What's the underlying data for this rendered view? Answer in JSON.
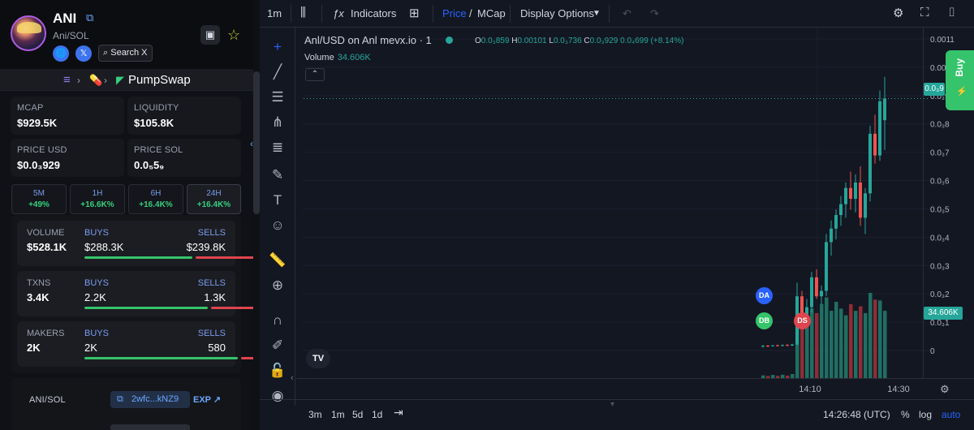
{
  "token": {
    "name": "ANI",
    "pair": "Ani/SOL",
    "search_label": "Search X"
  },
  "breadcrumb": {
    "dex": "PumpSwap"
  },
  "metrics": {
    "mcap_label": "MCAP",
    "mcap_value": "$929.5K",
    "liquidity_label": "LIQUIDITY",
    "liquidity_value": "$105.8K",
    "price_usd_label": "PRICE USD",
    "price_usd_value": "$0.0₃929",
    "price_sol_label": "PRICE SOL",
    "price_sol_value": "0.0₅5₉"
  },
  "timeframes": [
    {
      "label": "5M",
      "change": "+49%"
    },
    {
      "label": "1H",
      "change": "+16.6K%"
    },
    {
      "label": "6H",
      "change": "+16.4K%"
    },
    {
      "label": "24H",
      "change": "+16.4K%"
    }
  ],
  "stats": {
    "volume": {
      "label": "VOLUME",
      "value": "$528.1K",
      "buys_label": "BUYS",
      "buys": "$288.3K",
      "sells_label": "SELLS",
      "sells": "$239.8K",
      "buy_fraction": 0.55
    },
    "txns": {
      "label": "TXNS",
      "value": "3.4K",
      "buys_label": "BUYS",
      "buys": "2.2K",
      "sells_label": "SELLS",
      "sells": "1.3K",
      "buy_fraction": 0.63
    },
    "makers": {
      "label": "MAKERS",
      "value": "2K",
      "buys_label": "BUYS",
      "buys": "2K",
      "sells_label": "SELLS",
      "sells": "580",
      "buy_fraction": 0.78
    }
  },
  "pair_info": {
    "label": "ANI/SOL",
    "address": "2wfc...kNZ9",
    "exp_label": "EXP"
  },
  "chart_toolbar": {
    "interval": "1m",
    "indicators": "Indicators",
    "price_label": "Price",
    "mcap_label": "MCap",
    "display_options": "Display Options"
  },
  "chart_legend": {
    "symbol": "Anl/USD on Anl mevx.io · 1",
    "o_label": "O",
    "o_value": "0.0₃859",
    "h_label": "H",
    "h_value": "0.00101",
    "l_label": "L",
    "l_value": "0.0₃736",
    "c_label": "C",
    "c_value": "0.0₃929",
    "change": "0.0₄699 (+8.14%)",
    "volume_label": "Volume",
    "volume_value": "34.606K"
  },
  "markers": {
    "da": "DA",
    "db": "DB",
    "ds": "DS"
  },
  "price_tags": {
    "volume_tag": "34.606K",
    "price_tag": "0.0₃9"
  },
  "bottombar": {
    "ranges": [
      "3m",
      "1m",
      "5d",
      "1d"
    ],
    "time": "14:26:48 (UTC)",
    "percent": "%",
    "log": "log",
    "auto": "auto"
  },
  "buy_button": {
    "label": "Buy"
  },
  "chart_data": {
    "type": "candlestick",
    "y_ticks": [
      "0.0011",
      "0.001",
      "0.0₃9",
      "0.0₃8",
      "0.0₃7",
      "0.0₃6",
      "0.0₃5",
      "0.0₃4",
      "0.0₃3",
      "0.0₃2",
      "0.0₃1",
      "0"
    ],
    "ylim": [
      0,
      0.00115
    ],
    "x_ticks": [
      "14:10",
      "14:30"
    ],
    "candles": [
      {
        "o": 1.5e-05,
        "h": 2e-05,
        "l": 1e-05,
        "c": 1.8e-05
      },
      {
        "o": 1.8e-05,
        "h": 2e-05,
        "l": 1.2e-05,
        "c": 1.6e-05
      },
      {
        "o": 1.6e-05,
        "h": 2e-05,
        "l": 1.4e-05,
        "c": 1.9e-05
      },
      {
        "o": 1.9e-05,
        "h": 2.2e-05,
        "l": 1.5e-05,
        "c": 1.7e-05
      },
      {
        "o": 1.7e-05,
        "h": 2.2e-05,
        "l": 1.5e-05,
        "c": 2e-05
      },
      {
        "o": 2e-05,
        "h": 2.4e-05,
        "l": 1.6e-05,
        "c": 1.8e-05
      },
      {
        "o": 1.8e-05,
        "h": 2.5e-05,
        "l": 1.7e-05,
        "c": 2.2e-05
      },
      {
        "o": 2.2e-05,
        "h": 0.00025,
        "l": 2e-05,
        "c": 0.0002
      },
      {
        "o": 0.0002,
        "h": 0.00022,
        "l": 0.00011,
        "c": 0.00012
      },
      {
        "o": 0.00012,
        "h": 0.00019,
        "l": 0.0001,
        "c": 0.00016
      },
      {
        "o": 0.00016,
        "h": 0.00029,
        "l": 0.00014,
        "c": 0.00027
      },
      {
        "o": 0.00027,
        "h": 0.0003,
        "l": 0.00019,
        "c": 0.0002
      },
      {
        "o": 0.0002,
        "h": 0.00024,
        "l": 0.00017,
        "c": 0.00022
      },
      {
        "o": 0.00022,
        "h": 0.00043,
        "l": 0.0002,
        "c": 0.0004
      },
      {
        "o": 0.0004,
        "h": 0.00048,
        "l": 0.00035,
        "c": 0.00045
      },
      {
        "o": 0.00045,
        "h": 0.00052,
        "l": 0.00041,
        "c": 0.0005
      },
      {
        "o": 0.0005,
        "h": 0.00057,
        "l": 0.00046,
        "c": 0.00054
      },
      {
        "o": 0.00054,
        "h": 0.00062,
        "l": 0.00049,
        "c": 0.0006
      },
      {
        "o": 0.0006,
        "h": 0.00066,
        "l": 0.00052,
        "c": 0.00056
      },
      {
        "o": 0.00056,
        "h": 0.00065,
        "l": 0.00051,
        "c": 0.00062
      },
      {
        "o": 0.00062,
        "h": 0.00068,
        "l": 0.00046,
        "c": 0.00049
      },
      {
        "o": 0.00049,
        "h": 0.0006,
        "l": 0.00043,
        "c": 0.00058
      },
      {
        "o": 0.00058,
        "h": 0.00083,
        "l": 0.00055,
        "c": 0.0008
      },
      {
        "o": 0.0008,
        "h": 0.00087,
        "l": 0.00069,
        "c": 0.00072
      },
      {
        "o": 0.00072,
        "h": 0.00096,
        "l": 0.0007,
        "c": 0.00092
      },
      {
        "o": 0.00085,
        "h": 0.00101,
        "l": 0.00074,
        "c": 0.00093
      }
    ],
    "volumes": [
      1200,
      900,
      1400,
      1000,
      1500,
      1100,
      1800,
      22000,
      26000,
      24000,
      31000,
      29000,
      33000,
      36000,
      30000,
      34000,
      31000,
      28000,
      33000,
      30000,
      32000,
      29000,
      38000,
      35000,
      34606,
      30000
    ]
  }
}
